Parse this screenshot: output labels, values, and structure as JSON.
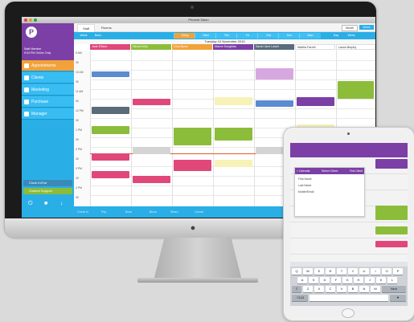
{
  "window": {
    "title": "Phorest Salon"
  },
  "sidebar": {
    "logo_letter": "P",
    "user_line1": "Staff Member",
    "user_line2": "9:04 PM Online Only",
    "items": [
      {
        "label": "Appointments",
        "active": true
      },
      {
        "label": "Clients"
      },
      {
        "label": "Marketing"
      },
      {
        "label": "Purchase"
      },
      {
        "label": "Manager"
      }
    ],
    "bottom1": "Clock In/Out",
    "bottom2": "Custom Support"
  },
  "tabs": {
    "staff": "Staff",
    "rooms": "Rooms"
  },
  "view_buttons": {
    "month": "Month",
    "week": "Week"
  },
  "navbar": {
    "week": "Week",
    "back": "Back",
    "days": [
      "Today",
      "Wed",
      "Thu",
      "Fri",
      "Sat",
      "Sun",
      "Mon"
    ],
    "right_day": "Day",
    "right_week": "Week"
  },
  "date_label": "Tuesday 10 November 2015",
  "staff": [
    {
      "name": "Jade Ellison",
      "color": "#e0487a"
    },
    {
      "name": "Nicola Kelly",
      "color": "#8cbd3a"
    },
    {
      "name": "Gina Byrne",
      "color": "#f2a23a"
    },
    {
      "name": "Maeve Doughlas",
      "color": "#7b3fa6"
    },
    {
      "name": "Sarah Jane Leach",
      "color": "#5a6b7a"
    },
    {
      "name": "Martha Farrell",
      "color": "#ffffff"
    },
    {
      "name": "Laura Murphy",
      "color": "#ffffff"
    }
  ],
  "times": [
    "9 AM",
    "30",
    "10 AM",
    "30",
    "11 AM",
    "30",
    "12 PM",
    "30",
    "1 PM",
    "30",
    "2 PM",
    "30",
    "3 PM",
    "30",
    "4 PM",
    "30"
  ],
  "bottom_bar": [
    "Check In",
    "Pay",
    "Book",
    "Block",
    "Share",
    "Cancel"
  ],
  "ipad": {
    "dialog_title": "Select Client",
    "back": "< Calendar",
    "done": "Find Client",
    "rows": [
      "First Name",
      "Last Name",
      "Mobile/Email"
    ]
  },
  "keyboard": {
    "row1": [
      "Q",
      "W",
      "E",
      "R",
      "T",
      "Y",
      "U",
      "I",
      "O",
      "P"
    ],
    "row2": [
      "A",
      "S",
      "D",
      "F",
      "G",
      "H",
      "J",
      "K",
      "L"
    ],
    "row3": [
      "Z",
      "X",
      "C",
      "V",
      "B",
      "N",
      "M"
    ],
    "next": "Next"
  }
}
